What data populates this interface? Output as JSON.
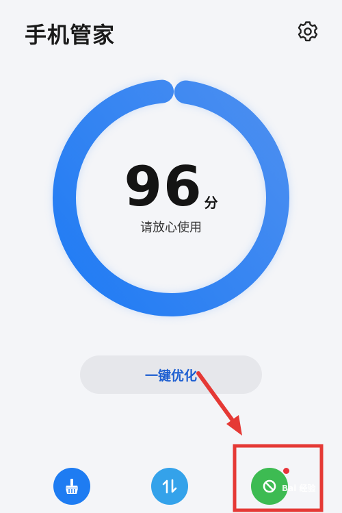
{
  "header": {
    "title": "手机管家",
    "settings_icon": "gear-icon"
  },
  "score": {
    "value": "96",
    "unit": "分",
    "status": "请放心使用",
    "ring_color": "#2f86f5"
  },
  "actions": {
    "optimize_label": "一键优化"
  },
  "bottom_nav": [
    {
      "icon": "broom-icon",
      "color": "#1e7cf2"
    },
    {
      "icon": "data-arrows-icon",
      "color": "#34a2ea"
    },
    {
      "icon": "block-icon",
      "color": "#3dbb52",
      "has_badge": true
    }
  ],
  "annotation": {
    "arrow_color": "#e53935",
    "box_color": "#e53935"
  },
  "watermark": {
    "text": "Bai 经验"
  }
}
